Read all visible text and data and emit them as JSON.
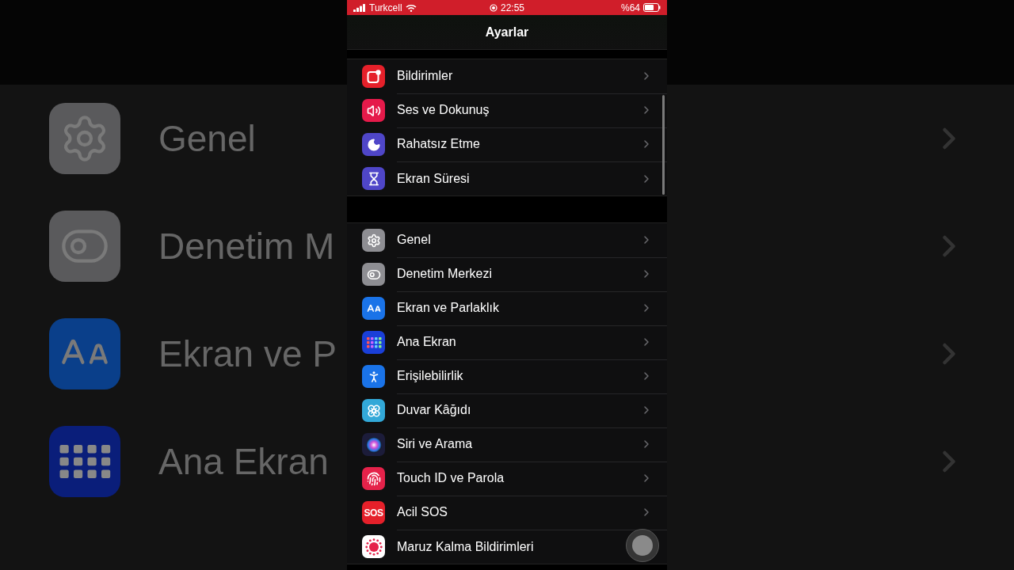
{
  "backdrop": {
    "items": [
      {
        "label": "Genel",
        "color": "#5a5a5c"
      },
      {
        "label": "Denetim M",
        "color": "#5a5a5c"
      },
      {
        "label": "Ekran ve P",
        "color": "#0a3f8a"
      },
      {
        "label": "Ana Ekran",
        "color": "#0a1e7a"
      }
    ]
  },
  "status_bar": {
    "carrier": "Turkcell",
    "time": "22:55",
    "battery": "%64"
  },
  "nav": {
    "title": "Ayarlar"
  },
  "groups": [
    {
      "items": [
        {
          "label": "Bildirimler",
          "color": "#e5202a"
        },
        {
          "label": "Ses ve Dokunuş",
          "color": "#e51a4a"
        },
        {
          "label": "Rahatsız Etme",
          "color": "#4f46c8"
        },
        {
          "label": "Ekran Süresi",
          "color": "#4f46c8"
        }
      ]
    },
    {
      "items": [
        {
          "label": "Genel",
          "color": "#8e8e93"
        },
        {
          "label": "Denetim Merkezi",
          "color": "#8e8e93"
        },
        {
          "label": "Ekran ve Parlaklık",
          "color": "#1a73e8"
        },
        {
          "label": "Ana Ekran",
          "color": "#1a3fd8"
        },
        {
          "label": "Erişilebilirlik",
          "color": "#1a73e8"
        },
        {
          "label": "Duvar Kâğıdı",
          "color": "#32a8d8"
        },
        {
          "label": "Siri ve Arama",
          "color": "#1c1c3a"
        },
        {
          "label": "Touch ID ve Parola",
          "color": "#e5224a"
        },
        {
          "label": "Acil SOS",
          "color": "#e5202a",
          "icon_text": "SOS"
        },
        {
          "label": "Maruz Kalma Bildirimleri",
          "color": "#ffffff"
        }
      ]
    }
  ]
}
